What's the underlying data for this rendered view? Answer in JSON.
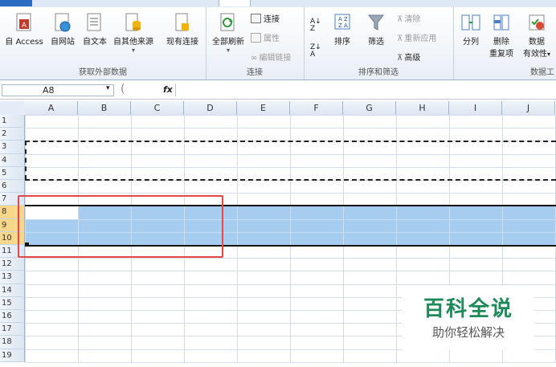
{
  "ribbon": {
    "groups": {
      "external": {
        "label": "获取外部数据",
        "buttons": [
          "自 Access",
          "自网站",
          "自文本",
          "自其他来源",
          "现有连接"
        ]
      },
      "connections": {
        "label": "连接",
        "refresh": "全部刷新",
        "connect": "连接",
        "properties": "属性",
        "edit_links": "编辑链接"
      },
      "sort_filter": {
        "label": "排序和筛选",
        "sort": "排序",
        "filter": "筛选",
        "clear": "清除",
        "reapply": "重新应用",
        "advanced": "高级"
      },
      "data_tools": {
        "label": "数据工",
        "split": "分列",
        "dedupe_1": "删除",
        "dedupe_2": "重复项",
        "validation_1": "数据",
        "validation_2": "有效性"
      }
    }
  },
  "formula_bar": {
    "name_box": "A8",
    "fx": "fx"
  },
  "sheet": {
    "columns": [
      "A",
      "B",
      "C",
      "D",
      "E",
      "F",
      "G",
      "H",
      "I",
      "J"
    ],
    "rows": [
      "1",
      "2",
      "3",
      "4",
      "5",
      "6",
      "7",
      "8",
      "9",
      "10",
      "11",
      "12",
      "13",
      "14",
      "15",
      "16",
      "17",
      "18",
      "19"
    ],
    "selected_rows": [
      "8",
      "9",
      "10"
    ]
  },
  "watermark": {
    "title": "百科全说",
    "subtitle": "助你轻松解决"
  },
  "colors": {
    "selection": "#a6cdf0",
    "highlight_box": "#e24a4a",
    "brand": "#1e8a5a"
  }
}
